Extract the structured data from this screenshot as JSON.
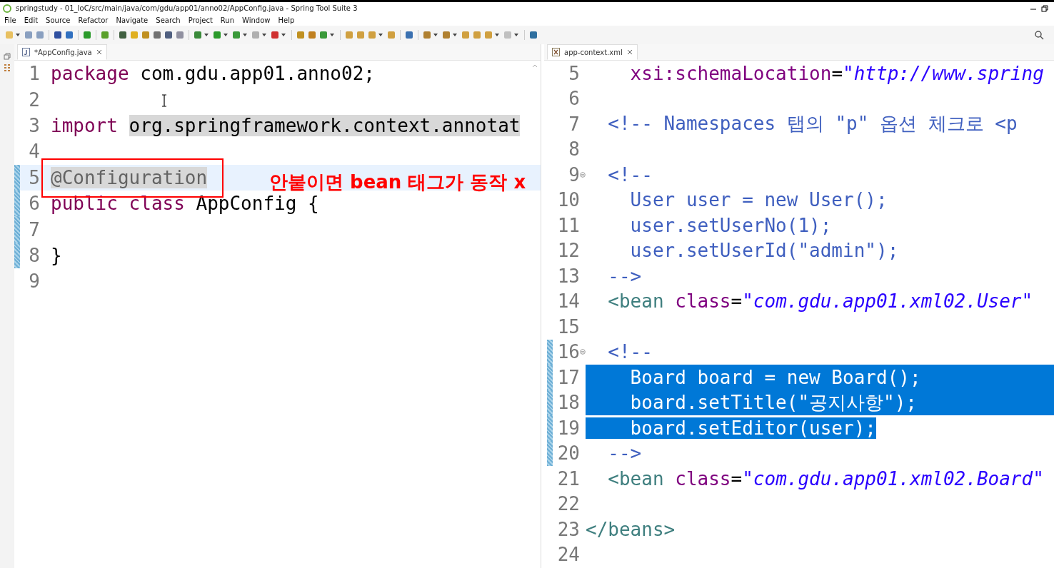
{
  "window": {
    "title": "springstudy - 01_IoC/src/main/java/com/gdu/app01/anno02/AppConfig.java - Spring Tool Suite 3"
  },
  "menu": [
    "File",
    "Edit",
    "Source",
    "Refactor",
    "Navigate",
    "Search",
    "Project",
    "Run",
    "Window",
    "Help"
  ],
  "editors": [
    {
      "tab": {
        "label": "*AppConfig.java",
        "selected": true,
        "kind": "java"
      },
      "lines": [
        {
          "number": "1",
          "changed": false,
          "current": false,
          "tokens": [
            {
              "text": "package",
              "kind": "keyword"
            },
            {
              "text": " com.gdu.app01.anno02;",
              "kind": "plain"
            }
          ]
        },
        {
          "number": "2",
          "changed": false,
          "current": false
        },
        {
          "number": "3",
          "changed": false,
          "current": false,
          "tokens": [
            {
              "text": "import ",
              "kind": "keyword"
            },
            {
              "text": "org.springframework.context.annotat",
              "kind": "folded"
            }
          ]
        },
        {
          "number": "4",
          "changed": false,
          "current": false
        },
        {
          "number": "5",
          "changed": true,
          "current": true,
          "tokens": [
            {
              "text": "@Configuration",
              "kind": "annotation"
            }
          ]
        },
        {
          "number": "6",
          "changed": true,
          "current": false,
          "tokens": [
            {
              "text": "public ",
              "kind": "keyword"
            },
            {
              "text": "class ",
              "kind": "keyword"
            },
            {
              "text": "AppConfig {",
              "kind": "plain"
            }
          ]
        },
        {
          "number": "7",
          "changed": true,
          "current": false
        },
        {
          "number": "8",
          "changed": true,
          "current": false,
          "tokens": [
            {
              "text": "}",
              "kind": "plain"
            }
          ]
        },
        {
          "number": "9",
          "changed": false,
          "current": false
        }
      ]
    },
    {
      "tab": {
        "label": "app-context.xml",
        "selected": true,
        "kind": "xml"
      },
      "lines": [
        {
          "number": "5",
          "changed": false,
          "fold": false,
          "selected": false,
          "tokens": [
            {
              "text": "    xsi:schemaLocation",
              "kind": "attr"
            },
            {
              "text": "=",
              "kind": "plain"
            },
            {
              "text": "\"http://www.spring",
              "kind": "string"
            }
          ]
        },
        {
          "number": "6",
          "changed": false,
          "fold": false,
          "selected": false
        },
        {
          "number": "7",
          "changed": false,
          "fold": false,
          "selected": false,
          "tokens": [
            {
              "text": "  <!-- Namespaces 탭의 \"p\" 옵션 체크로 <p",
              "kind": "comment"
            }
          ]
        },
        {
          "number": "8",
          "changed": false,
          "fold": false,
          "selected": false
        },
        {
          "number": "9",
          "changed": false,
          "fold": true,
          "selected": false,
          "tokens": [
            {
              "text": "  <!--",
              "kind": "comment"
            }
          ]
        },
        {
          "number": "10",
          "changed": false,
          "fold": false,
          "selected": false,
          "tokens": [
            {
              "text": "    User user = new User();",
              "kind": "comment"
            }
          ]
        },
        {
          "number": "11",
          "changed": false,
          "fold": false,
          "selected": false,
          "tokens": [
            {
              "text": "    user.setUserNo(1);",
              "kind": "comment"
            }
          ]
        },
        {
          "number": "12",
          "changed": false,
          "fold": false,
          "selected": false,
          "tokens": [
            {
              "text": "    user.setUserId(\"admin\");",
              "kind": "comment"
            }
          ]
        },
        {
          "number": "13",
          "changed": false,
          "fold": false,
          "selected": false,
          "tokens": [
            {
              "text": "  -->",
              "kind": "comment"
            }
          ]
        },
        {
          "number": "14",
          "changed": false,
          "fold": false,
          "selected": false,
          "tokens": [
            {
              "text": "  <bean ",
              "kind": "tag"
            },
            {
              "text": "class",
              "kind": "attr"
            },
            {
              "text": "=",
              "kind": "plain"
            },
            {
              "text": "\"com.gdu.app01.xml02.User\"",
              "kind": "string"
            }
          ]
        },
        {
          "number": "15",
          "changed": false,
          "fold": false,
          "selected": false
        },
        {
          "number": "16",
          "changed": true,
          "fold": true,
          "selected": false,
          "tokens": [
            {
              "text": "  <!--",
              "kind": "comment"
            }
          ]
        },
        {
          "number": "17",
          "changed": true,
          "fold": false,
          "selected": true,
          "tokens": [
            {
              "text": "    Board board = new Board();",
              "kind": "comment"
            }
          ]
        },
        {
          "number": "18",
          "changed": true,
          "fold": false,
          "selected": true,
          "tokens": [
            {
              "text": "    board.setTitle(\"공지사항\");",
              "kind": "comment"
            }
          ]
        },
        {
          "number": "19",
          "changed": true,
          "fold": false,
          "selected": true,
          "tokens": [
            {
              "text": "    board.setEditor(user);",
              "kind": "comment"
            }
          ]
        },
        {
          "number": "20",
          "changed": true,
          "fold": false,
          "selected": false,
          "tokens": [
            {
              "text": "  -->",
              "kind": "comment"
            }
          ]
        },
        {
          "number": "21",
          "changed": false,
          "fold": false,
          "selected": false,
          "tokens": [
            {
              "text": "  <bean ",
              "kind": "tag"
            },
            {
              "text": "class",
              "kind": "attr"
            },
            {
              "text": "=",
              "kind": "plain"
            },
            {
              "text": "\"com.gdu.app01.xml02.Board\"",
              "kind": "string"
            }
          ]
        },
        {
          "number": "22",
          "changed": false,
          "fold": false,
          "selected": false
        },
        {
          "number": "23",
          "changed": false,
          "fold": false,
          "selected": false,
          "tokens": [
            {
              "text": "</beans>",
              "kind": "tag"
            }
          ]
        },
        {
          "number": "24",
          "changed": false,
          "fold": false,
          "selected": false
        }
      ]
    }
  ],
  "callout": {
    "text": "안붙이면 bean 태그가 동작 x"
  }
}
